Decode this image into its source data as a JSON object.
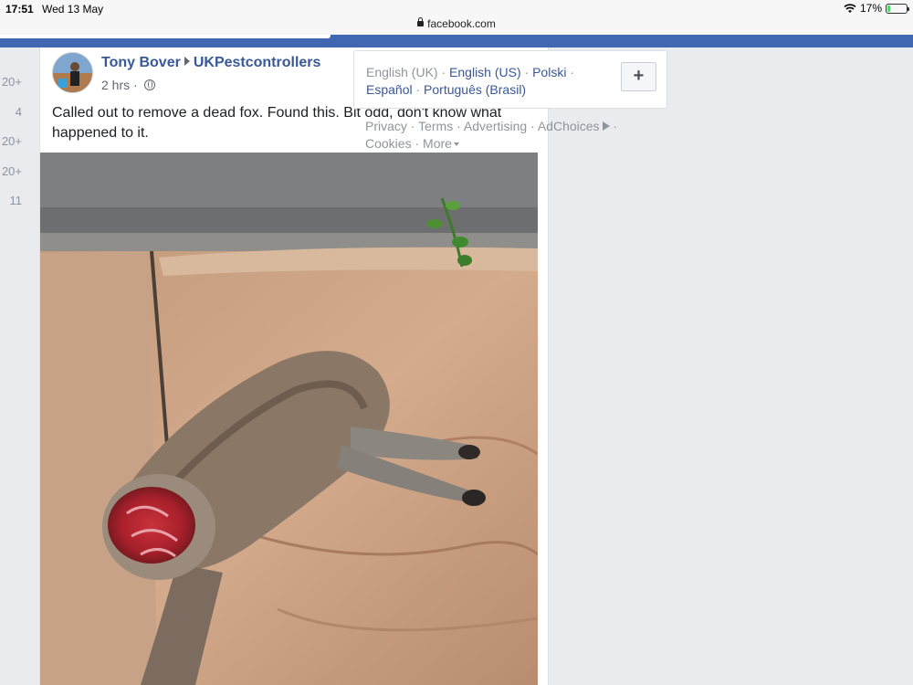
{
  "status_bar": {
    "time": "17:51",
    "date": "Wed 13 May",
    "url": "facebook.com",
    "battery": "17%",
    "battery_level": 0.17
  },
  "left_counts": [
    "20+",
    "4",
    "20+",
    "20+",
    "11"
  ],
  "post": {
    "author": "Tony Bover",
    "group": "UKPestcontrollers",
    "time": "2 hrs",
    "privacy_icon": "globe-icon",
    "text": "Called out to remove a dead fox. Found this. Bit odd, don't know what happened to it.",
    "more_icon": "ellipsis-icon"
  },
  "languages": {
    "current": "English (UK)",
    "options": [
      "English (US)",
      "Polski",
      "Español",
      "Português (Brasil)"
    ],
    "add_label": "+"
  },
  "footer_links": {
    "privacy": "Privacy",
    "terms": "Terms",
    "advertising": "Advertising",
    "adchoices": "AdChoices",
    "cookies": "Cookies",
    "more": "More"
  },
  "colors": {
    "header_blue": "#4267b2",
    "link_blue": "#385898",
    "muted_gray": "#90949c"
  }
}
